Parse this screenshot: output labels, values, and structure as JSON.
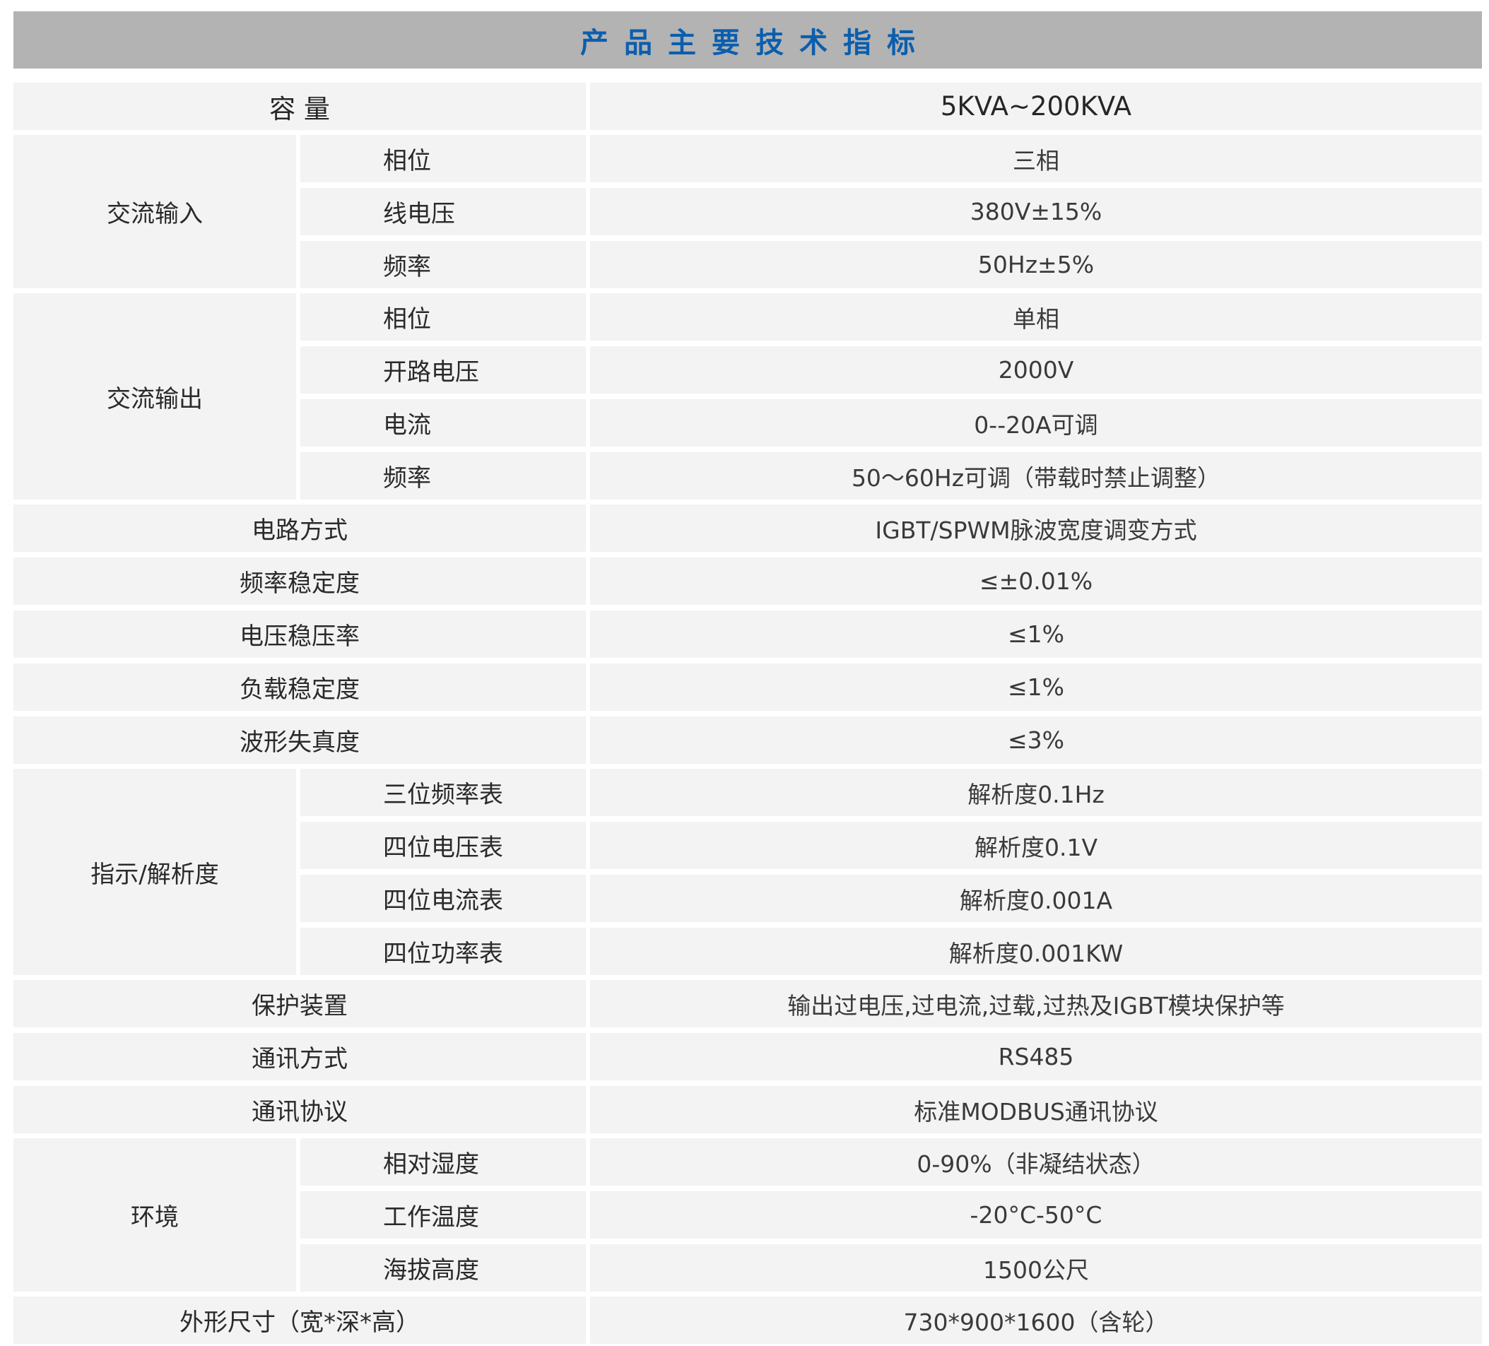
{
  "title": "产品主要技术指标",
  "spec_table": {
    "capacity": {
      "label": "容 量",
      "value": "5KVA~200KVA"
    },
    "ac_input": {
      "label": "交流输入",
      "rows": [
        {
          "label": "相位",
          "value": "三相"
        },
        {
          "label": "线电压",
          "value": "380V±15%"
        },
        {
          "label": "频率",
          "value": "50Hz±5%"
        }
      ]
    },
    "ac_output": {
      "label": "交流输出",
      "rows": [
        {
          "label": "相位",
          "value": "单相"
        },
        {
          "label": "开路电压",
          "value": "2000V"
        },
        {
          "label": "电流",
          "value": "0--20A可调"
        },
        {
          "label": "频率",
          "value": "50～60Hz可调（带载时禁止调整）"
        }
      ]
    },
    "circuit_mode": {
      "label": "电路方式",
      "value": "IGBT/SPWM脉波宽度调变方式"
    },
    "freq_stability": {
      "label": "频率稳定度",
      "value": "≤±0.01%"
    },
    "voltage_regulation": {
      "label": "电压稳压率",
      "value": "≤1%"
    },
    "load_stability": {
      "label": "负载稳定度",
      "value": "≤1%"
    },
    "waveform_distortion": {
      "label": "波形失真度",
      "value": "≤3%"
    },
    "indication": {
      "label": "指示/解析度",
      "rows": [
        {
          "label": "三位频率表",
          "value": "解析度0.1Hz"
        },
        {
          "label": "四位电压表",
          "value": "解析度0.1V"
        },
        {
          "label": "四位电流表",
          "value": "解析度0.001A"
        },
        {
          "label": "四位功率表",
          "value": "解析度0.001KW"
        }
      ]
    },
    "protection": {
      "label": "保护装置",
      "value": "输出过电压,过电流,过载,过热及IGBT模块保护等"
    },
    "comm_mode": {
      "label": "通讯方式",
      "value": "RS485"
    },
    "comm_protocol": {
      "label": "通讯协议",
      "value": "标准MODBUS通讯协议"
    },
    "environment": {
      "label": "环境",
      "rows": [
        {
          "label": "相对湿度",
          "value": "0-90%（非凝结状态）"
        },
        {
          "label": "工作温度",
          "value": "-20°C-50°C"
        },
        {
          "label": "海拔高度",
          "value": "1500公尺"
        }
      ]
    },
    "dimensions": {
      "label": "外形尺寸（宽*深*高）",
      "value": "730*900*1600（含轮）"
    }
  },
  "colors": {
    "title_bar_bg": "#b3b3b3",
    "title_text": "#0b5eae",
    "cell_bg": "#f3f3f3"
  }
}
